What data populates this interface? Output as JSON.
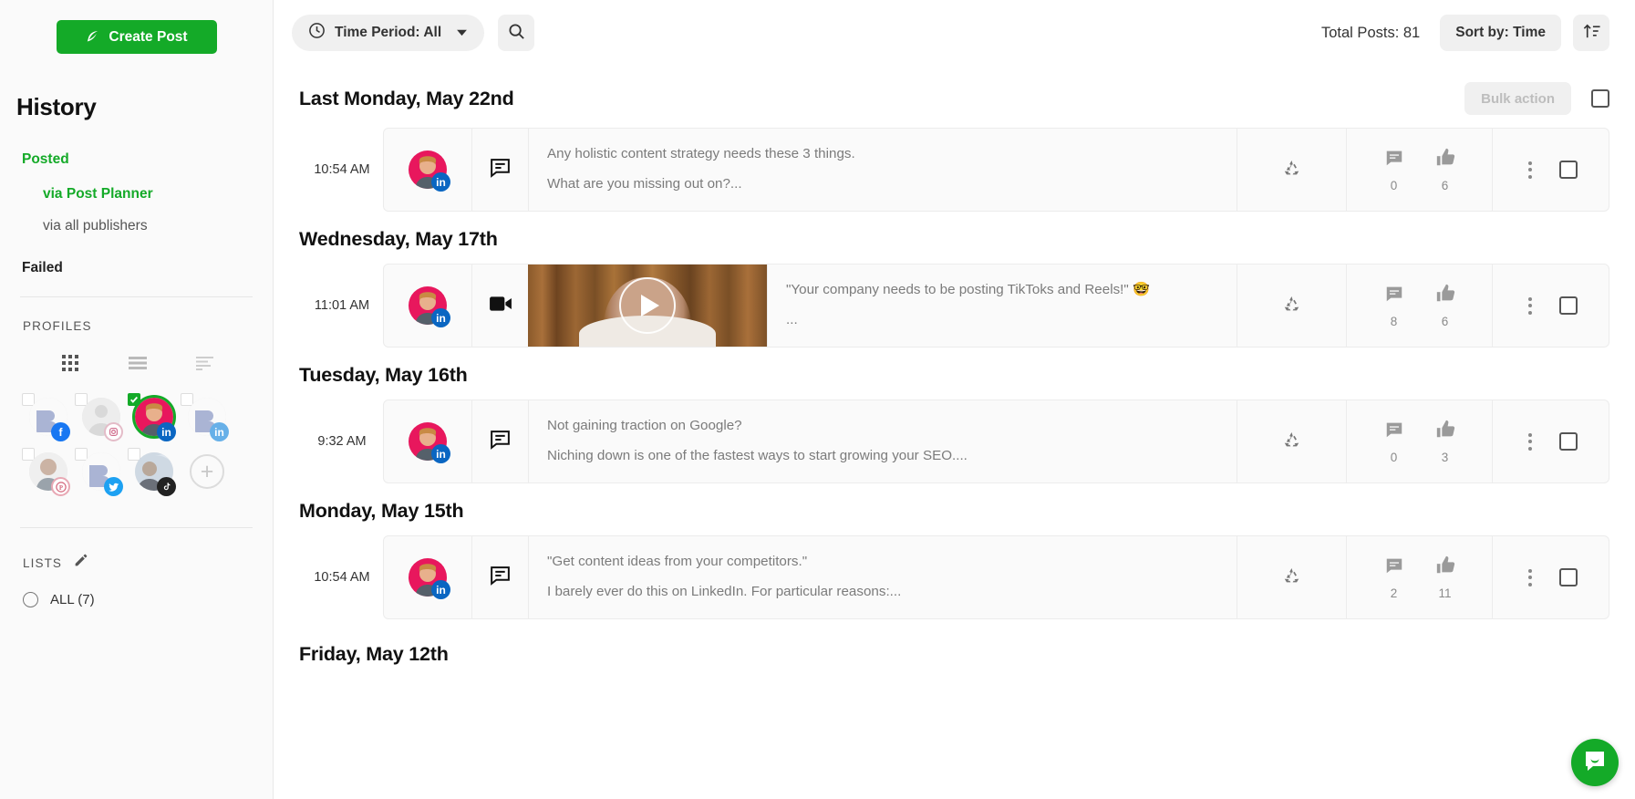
{
  "sidebar": {
    "create_post_label": "Create Post",
    "history_title": "History",
    "nav": {
      "posted": "Posted",
      "via_post_planner": "via Post Planner",
      "via_all_publishers": "via all publishers",
      "failed": "Failed"
    },
    "profiles_label": "PROFILES",
    "view_toggles": [
      "grid-view-icon",
      "list-view-icon",
      "compact-view-icon"
    ],
    "profiles": [
      {
        "name": "profile-facebook",
        "network": "facebook",
        "badge": "f",
        "selected": false,
        "checked": false,
        "avatar": "logo"
      },
      {
        "name": "profile-instagram",
        "network": "instagram",
        "badge": "ig",
        "selected": false,
        "checked": false,
        "avatar": "placeholder"
      },
      {
        "name": "profile-linkedin-personal",
        "network": "linkedin",
        "badge": "in",
        "selected": true,
        "checked": true,
        "avatar": "photo"
      },
      {
        "name": "profile-linkedin-company",
        "network": "linkedin",
        "badge": "in",
        "selected": false,
        "checked": false,
        "avatar": "logo"
      },
      {
        "name": "profile-pinterest",
        "network": "pinterest",
        "badge": "p",
        "selected": false,
        "checked": false,
        "avatar": "photo2"
      },
      {
        "name": "profile-twitter",
        "network": "twitter",
        "badge": "tw",
        "selected": false,
        "checked": false,
        "avatar": "logo"
      },
      {
        "name": "profile-tiktok",
        "network": "tiktok",
        "badge": "tk",
        "selected": false,
        "checked": false,
        "avatar": "photo3"
      },
      {
        "name": "add-profile",
        "network": "add",
        "badge": "+",
        "selected": false,
        "checked": false,
        "avatar": "add"
      }
    ],
    "lists_label": "LISTS",
    "lists": [
      {
        "label": "ALL (7)"
      }
    ]
  },
  "topbar": {
    "time_period_label": "Time Period: All",
    "search_icon": "search-icon",
    "total_posts": "Total Posts: 81",
    "sort_by_label": "Sort by: Time",
    "sort_direction_icon": "sort-ascending-icon"
  },
  "bulk_action_label": "Bulk action",
  "groups": [
    {
      "date": "Last Monday, May 22nd",
      "show_bulk": true,
      "posts": [
        {
          "time": "10:54 AM",
          "type": "text",
          "network": "linkedin",
          "badge": "in",
          "lines": [
            "Any holistic content strategy needs these 3 things.",
            "What are you missing out on?..."
          ],
          "recycle": true,
          "comments": "0",
          "likes": "6"
        }
      ]
    },
    {
      "date": "Wednesday, May 17th",
      "show_bulk": false,
      "posts": [
        {
          "time": "11:01 AM",
          "type": "video",
          "network": "linkedin",
          "badge": "in",
          "lines": [
            "\"Your company needs to be posting TikToks and Reels!\" 🤓",
            "..."
          ],
          "recycle": true,
          "comments": "8",
          "likes": "6"
        }
      ]
    },
    {
      "date": "Tuesday, May 16th",
      "show_bulk": false,
      "posts": [
        {
          "time": "9:32 AM",
          "type": "text",
          "network": "linkedin",
          "badge": "in",
          "lines": [
            "Not gaining traction on Google?",
            "Niching down is one of the fastest ways to start growing your SEO...."
          ],
          "recycle": true,
          "comments": "0",
          "likes": "3"
        }
      ]
    },
    {
      "date": "Monday, May 15th",
      "show_bulk": false,
      "posts": [
        {
          "time": "10:54 AM",
          "type": "text",
          "network": "linkedin",
          "badge": "in",
          "lines": [
            "\"Get content ideas from your competitors.\"",
            "I barely ever do this on LinkedIn. For particular reasons:..."
          ],
          "recycle": true,
          "comments": "2",
          "likes": "11"
        }
      ]
    },
    {
      "date": "Friday, May 12th",
      "show_bulk": false,
      "posts": []
    }
  ],
  "chat_widget": {
    "icon": "chat-bubble-icon",
    "color": "#14aa28"
  }
}
